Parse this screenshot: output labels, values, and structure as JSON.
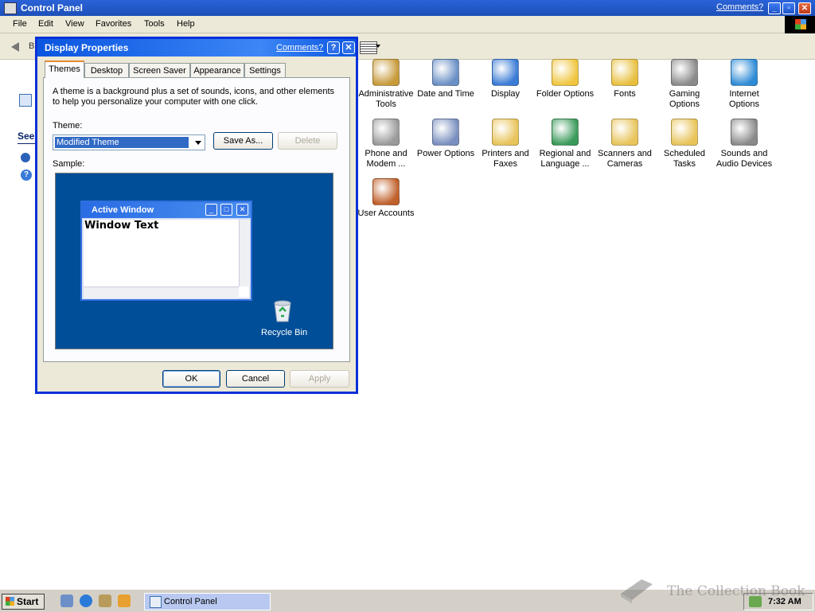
{
  "window": {
    "title": "Control Panel",
    "comments": "Comments?",
    "back_stub": "B"
  },
  "menu": [
    "File",
    "Edit",
    "View",
    "Favorites",
    "Tools",
    "Help"
  ],
  "left_panel": {
    "see_stub": "See"
  },
  "items": [
    {
      "label": "Administrative Tools",
      "icon": "administrative-tools-icon",
      "color": "#c79a3a"
    },
    {
      "label": "Date and Time",
      "icon": "date-time-icon",
      "color": "#6a8fc4"
    },
    {
      "label": "Display",
      "icon": "display-icon",
      "color": "#3a7bd5"
    },
    {
      "label": "Folder Options",
      "icon": "folder-options-icon",
      "color": "#f0c640"
    },
    {
      "label": "Fonts",
      "icon": "fonts-icon",
      "color": "#e8c040"
    },
    {
      "label": "Gaming Options",
      "icon": "gaming-options-icon",
      "color": "#8a8a8a"
    },
    {
      "label": "Internet Options",
      "icon": "internet-options-icon",
      "color": "#2e8bd6"
    },
    {
      "label": "Phone and Modem ...",
      "icon": "phone-modem-icon",
      "color": "#9a9a9a"
    },
    {
      "label": "Power Options",
      "icon": "power-options-icon",
      "color": "#7a8fbf"
    },
    {
      "label": "Printers and Faxes",
      "icon": "printers-faxes-icon",
      "color": "#e8c45a"
    },
    {
      "label": "Regional and Language ...",
      "icon": "regional-language-icon",
      "color": "#3a9a5a"
    },
    {
      "label": "Scanners and Cameras",
      "icon": "scanners-cameras-icon",
      "color": "#e8c45a"
    },
    {
      "label": "Scheduled Tasks",
      "icon": "scheduled-tasks-icon",
      "color": "#e8c45a"
    },
    {
      "label": "Sounds and Audio Devices",
      "icon": "sounds-audio-icon",
      "color": "#8a8a8a"
    },
    {
      "label": "User Accounts",
      "icon": "user-accounts-icon",
      "color": "#c0602a"
    }
  ],
  "dialog": {
    "title": "Display Properties",
    "comments": "Comments?",
    "help": "?",
    "tabs": [
      "Themes",
      "Desktop",
      "Screen Saver",
      "Appearance",
      "Settings"
    ],
    "active_tab": "Themes",
    "description": "A theme is a background plus a set of sounds, icons, and other elements to help you personalize your computer with one click.",
    "theme_label": "Theme:",
    "theme_value": "Modified Theme",
    "save_as": "Save As...",
    "delete": "Delete",
    "sample_label": "Sample:",
    "sample": {
      "window_title": "Active Window",
      "window_text": "Window Text",
      "recycle_bin": "Recycle Bin"
    },
    "ok": "OK",
    "cancel": "Cancel",
    "apply": "Apply"
  },
  "taskbar": {
    "start": "Start",
    "task": "Control Panel",
    "clock": "7:32 AM"
  },
  "watermark": "The Collection Book"
}
